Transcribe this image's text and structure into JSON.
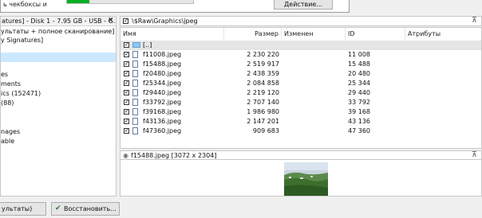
{
  "dialog": {
    "text": "ь чекбоксы и",
    "action_label": "Действие...",
    "progress_fraction": 0.18
  },
  "left_pane": {
    "header": "atures] - Disk 1 - 7.95 GB - USB - G...",
    "close": "✕",
    "items": [
      "ультаты + полное сканирование]",
      "y Signatures]",
      "",
      "es",
      "ments",
      "ics (152471)",
      " (88)",
      "",
      "nages",
      "able"
    ]
  },
  "path_bar": {
    "path": "\\$Raw\\Graphics\\jpeg",
    "pin": "⊼"
  },
  "columns": [
    "Имя",
    "Размер",
    "Изменен",
    "ID",
    "Атрибуты"
  ],
  "files": [
    {
      "name": "[..]",
      "size": "",
      "modified": "",
      "id": "",
      "is_parent": true
    },
    {
      "name": "f11008.jpeg",
      "size": "2 230 220",
      "modified": "",
      "id": "11 008"
    },
    {
      "name": "f15488.jpeg",
      "size": "2 519 917",
      "modified": "",
      "id": "15 488"
    },
    {
      "name": "f20480.jpeg",
      "size": "2 438 359",
      "modified": "",
      "id": "20 480"
    },
    {
      "name": "f25344.jpeg",
      "size": "2 084 858",
      "modified": "",
      "id": "25 344"
    },
    {
      "name": "f29440.jpeg",
      "size": "2 219 120",
      "modified": "",
      "id": "29 440"
    },
    {
      "name": "f33792.jpeg",
      "size": "2 707 140",
      "modified": "",
      "id": "33 792"
    },
    {
      "name": "f39168.jpeg",
      "size": "1 986 980",
      "modified": "",
      "id": "39 168"
    },
    {
      "name": "f43136.jpeg",
      "size": "2 147 201",
      "modified": "",
      "id": "43 136"
    },
    {
      "name": "f47360.jpeg",
      "size": "909 683",
      "modified": "",
      "id": "47 360"
    }
  ],
  "preview": {
    "title": "f15488.jpeg [3072 x 2304]",
    "pin": "⊼"
  },
  "bottom": {
    "left_label": "ультаты)",
    "restore_label": "Восстановить..."
  },
  "colors": {
    "progress": "#06b025",
    "selection": "#cce8ff",
    "folder": "#8fc8ee"
  },
  "icons": [
    "checkbox-icon",
    "folder-icon",
    "file-icon",
    "preview-icon",
    "restore-icon",
    "close-icon",
    "pin-icon"
  ]
}
